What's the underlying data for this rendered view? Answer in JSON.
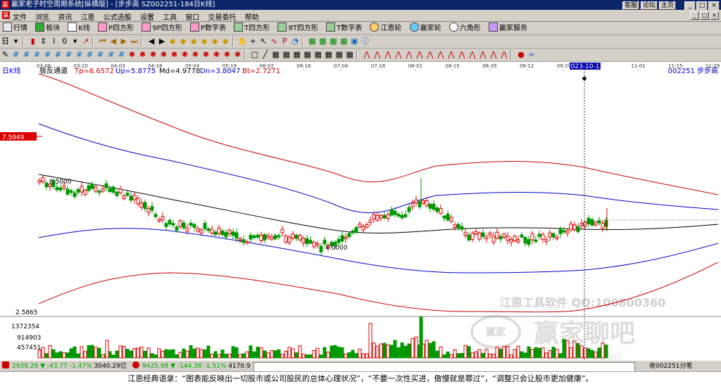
{
  "window": {
    "title": "赢家老子时空周期系统[纵横版] - [步步高   SZ002251-184日K线]",
    "top_links": [
      "客服",
      "论坛",
      "主页"
    ],
    "buttons": [
      "_",
      "□",
      "×"
    ]
  },
  "menu": {
    "items": [
      "文件",
      "浏览",
      "资讯",
      "江恩",
      "公式选股",
      "设置",
      "工具",
      "窗口",
      "交易委托",
      "帮助"
    ]
  },
  "toolbar1": {
    "buttons": [
      "行情",
      "板块",
      "K线",
      "P四方形",
      "9P四方形",
      "P数字表",
      "T四方形",
      "9T四方形",
      "T数字表",
      "江恩轮",
      "赢家轮",
      "六角形",
      "赢家服务"
    ]
  },
  "chart": {
    "period_label": "日K线",
    "indicator": {
      "name": "极反通道",
      "tp": "Tp=6.6572",
      "up": "Up=5.8775",
      "md": "Md=4.9778",
      "dn": "Dn=3.8047",
      "bt": "Bt=2.7271"
    },
    "stock_id": "002251  步步高",
    "date_ticks": [
      "03-06",
      "03-20",
      "04-03",
      "04-18",
      "05-04",
      "05-19",
      "06-02",
      "06-16",
      "07-04",
      "07-18",
      "08-01",
      "08-15",
      "08-29",
      "09-12",
      "09-26",
      "2023-10-13",
      "11-01",
      "11-15",
      "11-29"
    ],
    "highlight_date": "2023-10-13",
    "price_marker": "7.5949",
    "labels": {
      "p650": "6.5000",
      "p400": "4.0000",
      "bottom": "2.5865"
    },
    "volume_ticks": [
      "1372354",
      "914903",
      "457451"
    ],
    "watermark": {
      "line1": "江恩工具软件  QQ:100800360",
      "line2": "赢家聊吧",
      "logo": "赢家",
      "url": "jiaoba.yes.com"
    }
  },
  "status": {
    "sh_index": "2939.29",
    "sh_change": "-43.77",
    "sh_pct": "-1.47%",
    "sh_amt": "3040.29亿",
    "sz_index": "9425.98",
    "sz_change": "-144.38",
    "sz_pct": "-1.51%",
    "sz_amt": "4170.9",
    "right": "收002251分笔"
  },
  "quote": "江恩经典语录：“图表能反映出一切股市或公司股民的总体心理状况”，“不要一次性买进，傲慢就是罪过”，“调整只会让股市更加健康”。"
}
